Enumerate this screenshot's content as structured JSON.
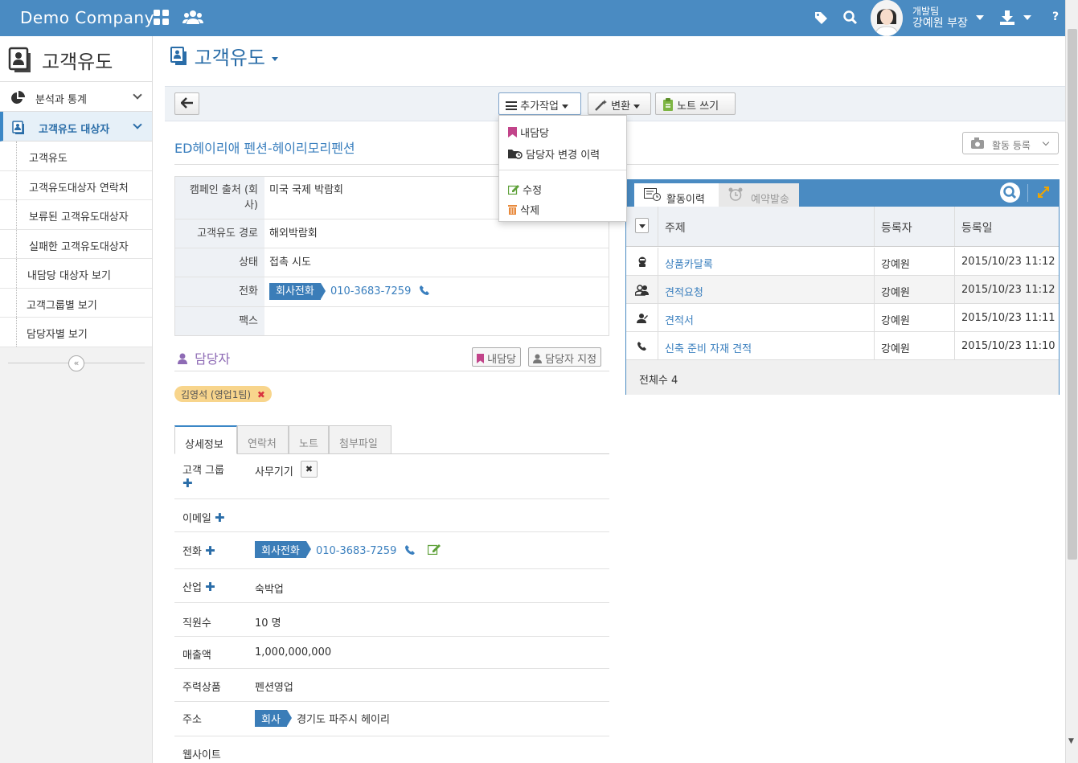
{
  "topbar": {
    "brand": "Demo Company",
    "user_team": "개발팀",
    "user_name": "강예원 부장"
  },
  "sidebar": {
    "title": "고객유도",
    "groups": [
      {
        "label": "분석과 통계"
      },
      {
        "label": "고객유도 대상자"
      }
    ],
    "items": [
      {
        "label": "고객유도"
      },
      {
        "label": "고객유도대상자 연락처"
      },
      {
        "label": "보류된 고객유도대상자"
      },
      {
        "label": "실패한 고객유도대상자"
      },
      {
        "label": "내담당 대상자 보기"
      },
      {
        "label": "고객그룹별 보기"
      },
      {
        "label": "담당자별 보기"
      }
    ]
  },
  "page": {
    "title": "고객유도"
  },
  "toolbar": {
    "more_actions": "추가작업",
    "convert": "변환",
    "write_note": "노트 쓰기"
  },
  "dropdown": {
    "items": [
      {
        "label": "내담당"
      },
      {
        "label": "담당자 변경 이력"
      },
      {
        "label": "수정"
      },
      {
        "label": "삭제"
      }
    ]
  },
  "record": {
    "title": "ED헤이리애 펜션-헤이리모리펜션",
    "activity_register": "활동 등록"
  },
  "info": {
    "rows": [
      {
        "label": "캠페인 출처 (회사)",
        "value": "미국 국제 박람회"
      },
      {
        "label": "고객유도 경로",
        "value": "해외박람회"
      },
      {
        "label": "상태",
        "value": "접촉 시도"
      },
      {
        "label": "전화",
        "tag": "회사전화",
        "value": "010-3683-7259"
      },
      {
        "label": "팩스",
        "value": ""
      }
    ]
  },
  "owner": {
    "title": "담당자",
    "mine_button": "내담당",
    "assign_button": "담당자 지정",
    "pill": "김영석 (영업1팀)"
  },
  "tabs": [
    {
      "label": "상세정보"
    },
    {
      "label": "연락처"
    },
    {
      "label": "노트"
    },
    {
      "label": "첨부파일"
    }
  ],
  "details": {
    "customer_group": {
      "label": "고객 그룹",
      "value": "사무기기"
    },
    "email": {
      "label": "이메일"
    },
    "phone": {
      "label": "전화",
      "tag": "회사전화",
      "value": "010-3683-7259"
    },
    "industry": {
      "label": "산업",
      "value": "숙박업"
    },
    "employees": {
      "label": "직원수",
      "value": "10 명"
    },
    "revenue": {
      "label": "매출액",
      "value": "1,000,000,000"
    },
    "main_product": {
      "label": "주력상품",
      "value": "펜션영업"
    },
    "address": {
      "label": "주소",
      "tag": "회사",
      "value": "경기도 파주시 헤이리"
    },
    "website": {
      "label": "웹사이트"
    }
  },
  "activity": {
    "tab_history": "활동이력",
    "tab_reserved": "예약발송",
    "columns": [
      "주제",
      "등록자",
      "등록일"
    ],
    "rows": [
      {
        "icon": "catalog-icon",
        "subject": "상품카달록",
        "registrant": "강예원",
        "date": "2015/10/23 11:12"
      },
      {
        "icon": "quote-request-icon",
        "subject": "견적요청",
        "registrant": "강예원",
        "date": "2015/10/23 11:12"
      },
      {
        "icon": "quote-icon",
        "subject": "견적서",
        "registrant": "강예원",
        "date": "2015/10/23 11:11"
      },
      {
        "icon": "phone-icon",
        "subject": "신축 준비 자재 견적",
        "registrant": "강예원",
        "date": "2015/10/23 11:10"
      }
    ],
    "total": "전체수 4"
  },
  "colors": {
    "brand": "#4a8bc2",
    "link": "#3a7fbe",
    "owner_title": "#8e6bb5",
    "pill": "#f8d58c"
  }
}
